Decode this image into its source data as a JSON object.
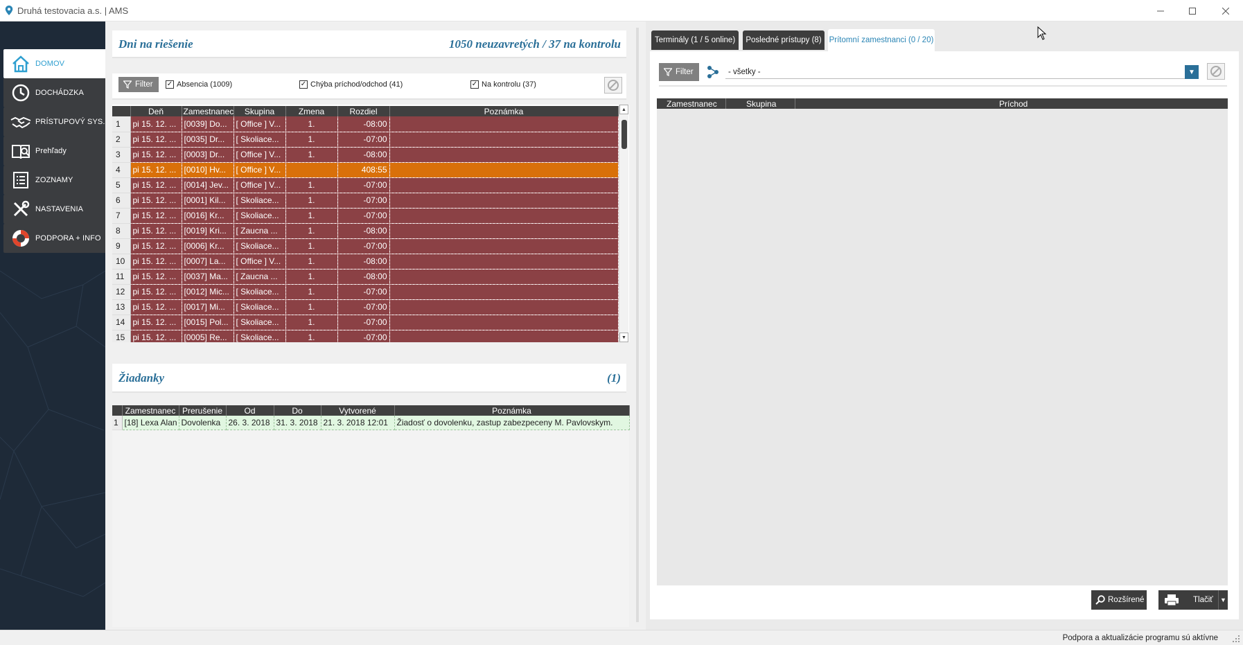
{
  "window": {
    "title": "Druhá testovacia a.s. | AMS"
  },
  "sidebar": {
    "items": [
      {
        "label": "DOMOV",
        "icon": "home-icon"
      },
      {
        "label": "DOCHÁDZKA",
        "icon": "clock-icon"
      },
      {
        "label": "PRÍSTUPOVÝ SYS.",
        "icon": "handshake-icon"
      },
      {
        "label": "Prehľady",
        "icon": "book-search-icon"
      },
      {
        "label": "ZOZNAMY",
        "icon": "list-icon"
      },
      {
        "label": "NASTAVENIA",
        "icon": "tools-icon"
      },
      {
        "label": "PODPORA + INFO",
        "icon": "lifebuoy-icon"
      }
    ]
  },
  "days": {
    "title": "Dni na riešenie",
    "summary": "1050 neuzavretých / 37 na kontrolu",
    "filter_label": "Filter",
    "filters": [
      {
        "label": "Absencia (1009)",
        "checked": true
      },
      {
        "label": "Chýba príchod/odchod (41)",
        "checked": true
      },
      {
        "label": "Na kontrolu (37)",
        "checked": true
      }
    ],
    "columns": [
      "Deň",
      "Zamestnanec",
      "Skupina",
      "Zmena",
      "Rozdiel",
      "Poznámka"
    ],
    "rows": [
      {
        "n": "1",
        "day": "pi 15. 12. ...",
        "emp": "[0039] Do...",
        "group": "[ Office ]  V...",
        "shift": "1.",
        "diff": "-08:00",
        "note": ""
      },
      {
        "n": "2",
        "day": "pi 15. 12. ...",
        "emp": "[0035] Dr...",
        "group": "[ Skoliace...",
        "shift": "1.",
        "diff": "-07:00",
        "note": ""
      },
      {
        "n": "3",
        "day": "pi 15. 12. ...",
        "emp": "[0003] Dr...",
        "group": "[ Office ]  V...",
        "shift": "1.",
        "diff": "-08:00",
        "note": ""
      },
      {
        "n": "4",
        "day": "pi 15. 12. ...",
        "emp": "[0010] Hv...",
        "group": "[ Office ]  V...",
        "shift": "",
        "diff": "408:55",
        "note": "",
        "highlight": true
      },
      {
        "n": "5",
        "day": "pi 15. 12. ...",
        "emp": "[0014] Jev...",
        "group": "[ Office ]  V...",
        "shift": "1.",
        "diff": "-07:00",
        "note": ""
      },
      {
        "n": "6",
        "day": "pi 15. 12. ...",
        "emp": "[0001] Kil...",
        "group": "[ Skoliace...",
        "shift": "1.",
        "diff": "-07:00",
        "note": ""
      },
      {
        "n": "7",
        "day": "pi 15. 12. ...",
        "emp": "[0016] Kr...",
        "group": "[ Skoliace...",
        "shift": "1.",
        "diff": "-07:00",
        "note": ""
      },
      {
        "n": "8",
        "day": "pi 15. 12. ...",
        "emp": "[0019] Kri...",
        "group": "[ Zaucna ...",
        "shift": "1.",
        "diff": "-08:00",
        "note": ""
      },
      {
        "n": "9",
        "day": "pi 15. 12. ...",
        "emp": "[0006] Kr...",
        "group": "[ Skoliace...",
        "shift": "1.",
        "diff": "-07:00",
        "note": ""
      },
      {
        "n": "10",
        "day": "pi 15. 12. ...",
        "emp": "[0007] La...",
        "group": "[ Office ]  V...",
        "shift": "1.",
        "diff": "-08:00",
        "note": ""
      },
      {
        "n": "11",
        "day": "pi 15. 12. ...",
        "emp": "[0037] Ma...",
        "group": "[ Zaucna ...",
        "shift": "1.",
        "diff": "-08:00",
        "note": ""
      },
      {
        "n": "12",
        "day": "pi 15. 12. ...",
        "emp": "[0012] Mic...",
        "group": "[ Skoliace...",
        "shift": "1.",
        "diff": "-07:00",
        "note": ""
      },
      {
        "n": "13",
        "day": "pi 15. 12. ...",
        "emp": "[0017] Mi...",
        "group": "[ Skoliace...",
        "shift": "1.",
        "diff": "-07:00",
        "note": ""
      },
      {
        "n": "14",
        "day": "pi 15. 12. ...",
        "emp": "[0015] Pol...",
        "group": "[ Skoliace...",
        "shift": "1.",
        "diff": "-07:00",
        "note": ""
      },
      {
        "n": "15",
        "day": "pi 15. 12. ...",
        "emp": "[0005] Re...",
        "group": "[ Skoliace...",
        "shift": "1.",
        "diff": "-07:00",
        "note": ""
      }
    ]
  },
  "requests": {
    "title": "Žiadanky",
    "count": "(1)",
    "columns": [
      "Zamestnanec",
      "Prerušenie",
      "Od",
      "Do",
      "Vytvorené",
      "Poznámka"
    ],
    "rows": [
      {
        "n": "1",
        "emp": "[18] Lexa Alan",
        "type": "Dovolenka",
        "from": "26. 3. 2018",
        "to": "31. 3. 2018",
        "created": "21. 3. 2018  12:01",
        "note": "Žiadosť o dovolenku, zastup zabezpeceny M. Pavlovskym."
      }
    ]
  },
  "right": {
    "tabs": [
      {
        "label": "Terminály (1 / 5 online)",
        "active": false
      },
      {
        "label": "Posledné prístupy (8)",
        "active": false
      },
      {
        "label": "Prítomní zamestnanci (0 / 20)",
        "active": true
      }
    ],
    "filter_label": "Filter",
    "group_select": "- všetky -",
    "columns": [
      "Zamestnanec",
      "Skupina",
      "Príchod"
    ],
    "btn_extended": "Rozšírené",
    "btn_print": "Tlačiť"
  },
  "status": {
    "text": "Podpora a aktualizácie programu sú aktívne"
  },
  "colors": {
    "accent": "#2a6f98",
    "row_red": "#8b4145",
    "row_orange": "#d9700a",
    "row_green": "#e1f7e1",
    "sidebar": "#1e2a38"
  }
}
